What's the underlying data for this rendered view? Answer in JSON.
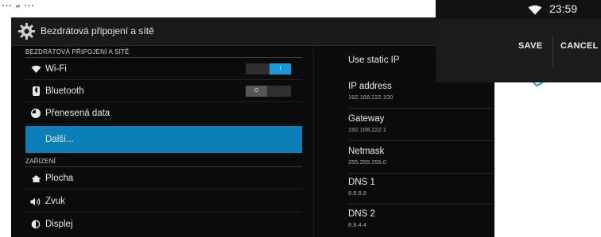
{
  "caption": {
    "text": "… „ …"
  },
  "topbar": {
    "title": "Bezdrátová připojení a sítě"
  },
  "sections": {
    "wireless": "BEZDRÁTOVÁ PŘIPOJENÍ A SÍTĚ",
    "device": "ZAŘÍZENÍ"
  },
  "items": {
    "wifi": {
      "label": "Wi-Fi",
      "toggle": "I"
    },
    "bluetooth": {
      "label": "Bluetooth",
      "toggle": "O"
    },
    "data": {
      "label": "Přenesená data"
    },
    "more": {
      "label": "Další..."
    },
    "home": {
      "label": "Plocha"
    },
    "sound": {
      "label": "Zvuk"
    },
    "display": {
      "label": "Displej"
    }
  },
  "static_ip": {
    "label": "Use static IP"
  },
  "fields": {
    "ip": {
      "name": "IP address",
      "value": "192.168.222.100"
    },
    "gateway": {
      "name": "Gateway",
      "value": "192.168.222.1"
    },
    "netmask": {
      "name": "Netmask",
      "value": "255.255.255.0"
    },
    "dns1": {
      "name": "DNS 1",
      "value": "8.8.8.8"
    },
    "dns2": {
      "name": "DNS 2",
      "value": "8.8.4.4"
    }
  },
  "status": {
    "time": "23:59"
  },
  "actions": {
    "save": "SAVE",
    "cancel": "CANCEL"
  },
  "colors": {
    "accent": "#0a7fb8",
    "toggle_on": "#1a9bd7",
    "background": "#0b0b0b"
  }
}
